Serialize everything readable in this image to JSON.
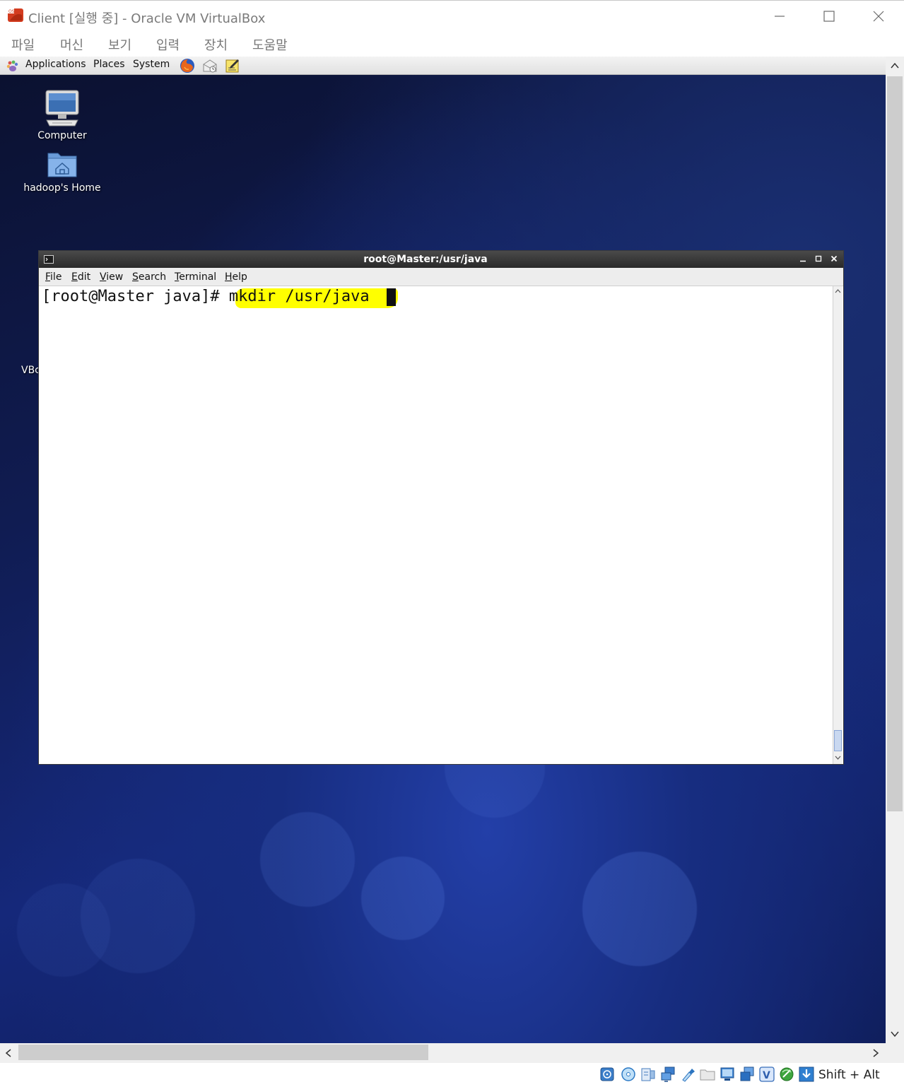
{
  "window": {
    "title": "Client [실행 중] - Oracle VM VirtualBox",
    "menu": [
      "파일",
      "머신",
      "보기",
      "입력",
      "장치",
      "도움말"
    ]
  },
  "guest_panel": {
    "menus": [
      "Applications",
      "Places",
      "System"
    ],
    "launchers": [
      "firefox-icon",
      "mail-client-icon",
      "notes-editor-icon"
    ]
  },
  "desktop": {
    "icons": [
      {
        "label": "Computer",
        "icon": "computer-icon"
      },
      {
        "label": "hadoop's Home",
        "icon": "home-folder-icon"
      }
    ],
    "partial_label": "VBc"
  },
  "terminal": {
    "title": "root@Master:/usr/java",
    "menu": [
      {
        "mnemonic": "F",
        "rest": "ile"
      },
      {
        "mnemonic": "E",
        "rest": "dit"
      },
      {
        "mnemonic": "V",
        "rest": "iew"
      },
      {
        "mnemonic": "S",
        "rest": "earch"
      },
      {
        "mnemonic": "T",
        "rest": "erminal"
      },
      {
        "mnemonic": "H",
        "rest": "elp"
      }
    ],
    "prompt": "[root@Master java]# ",
    "command": "mkdir /usr/java",
    "highlight_color": "#ffff00"
  },
  "statusbar": {
    "host_key": "Shift + Alt",
    "icons": [
      "hard-disk-icon",
      "optical-drive-icon",
      "audio-icon",
      "network-icon",
      "usb-icon",
      "shared-folders-icon",
      "display-icon",
      "video-capture-icon",
      "virtualization-icon",
      "mouse-integration-icon",
      "download-icon"
    ]
  }
}
